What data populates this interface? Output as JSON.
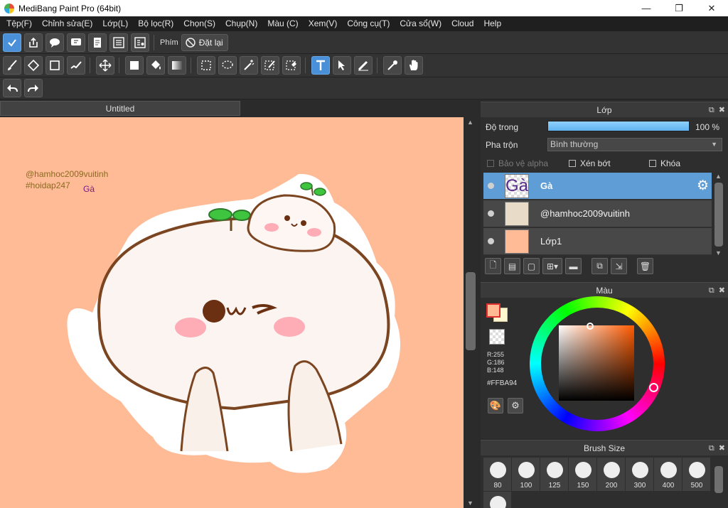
{
  "window": {
    "title": "MediBang Paint Pro (64bit)",
    "minimize": "—",
    "maximize": "❐",
    "close": "✕"
  },
  "menu": [
    "Tệp(F)",
    "Chỉnh sửa(E)",
    "Lớp(L)",
    "Bộ lọc(R)",
    "Chọn(S)",
    "Chụp(N)",
    "Màu (C)",
    "Xem(V)",
    "Công cụ(T)",
    "Cửa sổ(W)",
    "Cloud",
    "Help"
  ],
  "toolbar1": {
    "shortcut_label": "Phím",
    "reset_label": "Đặt lại"
  },
  "canvas": {
    "tab_title": "Untitled",
    "text_line1": "@hamhoc2009vuitinh",
    "text_line2": "#hoidap247",
    "text_ga": "Gà",
    "bg_color": "#ffbb96",
    "text_color1": "#8a6a20",
    "text_color2": "#7a1a8a"
  },
  "layers_panel": {
    "title": "Lớp",
    "opacity_label": "Độ trong",
    "opacity_value": "100 %",
    "opacity": 1.0,
    "blend_label": "Pha trộn",
    "blend_value": "Bình thường",
    "protect_alpha": "Bảo vệ alpha",
    "clipping": "Xén bớt",
    "lock": "Khóa",
    "layers": [
      {
        "name": "Gà",
        "thumb": "Gà",
        "selected": true
      },
      {
        "name": "@hamhoc2009vuitinh",
        "thumb": "",
        "selected": false
      },
      {
        "name": "Lớp1",
        "thumb": "",
        "selected": false
      }
    ]
  },
  "color_panel": {
    "title": "Màu",
    "r": "R:255",
    "g": "G:186",
    "b": "B:148",
    "hex": "#FFBA94",
    "fg_color": "#ffba94",
    "bg_color": "#fff7d0"
  },
  "brush_panel": {
    "title": "Brush Size",
    "sizes": [
      "80",
      "100",
      "125",
      "150",
      "200",
      "300",
      "400",
      "500"
    ]
  }
}
